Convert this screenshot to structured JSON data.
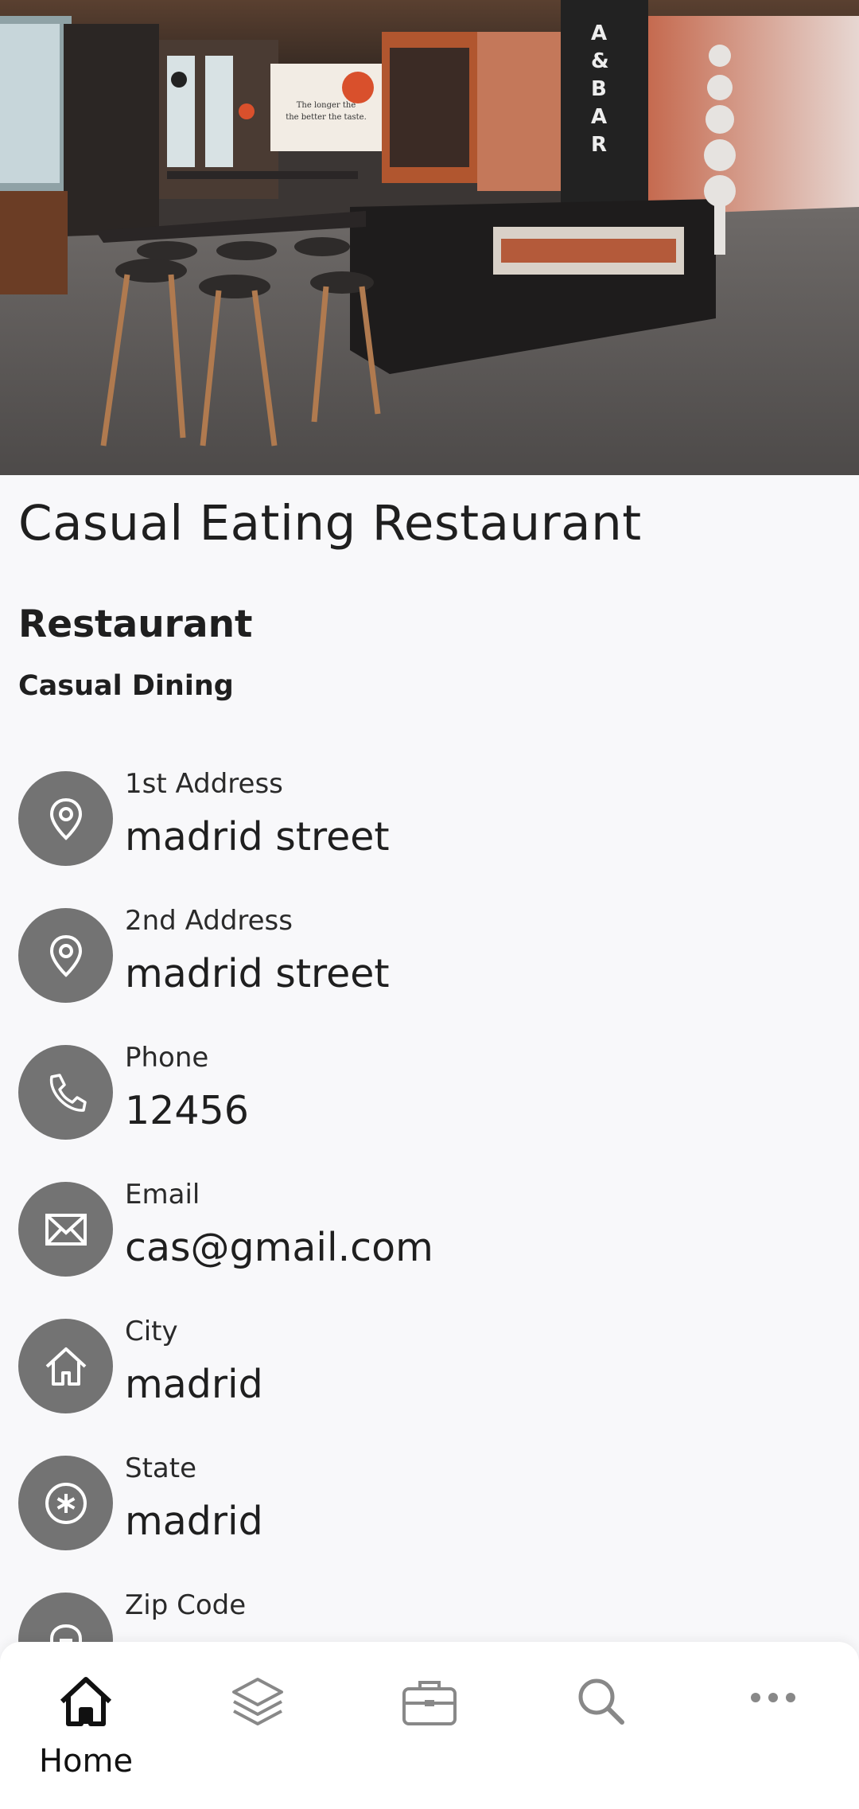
{
  "restaurant": {
    "name": "Casual Eating Restaurant",
    "category": "Restaurant",
    "subcategory": "Casual Dining"
  },
  "hero": {
    "signage": [
      "A",
      "&",
      "B",
      "A",
      "R"
    ],
    "board_lines": [
      "The longer the",
      "the better the taste."
    ]
  },
  "info": [
    {
      "label": "1st Address",
      "value": "madrid street",
      "icon": "location-pin-icon"
    },
    {
      "label": "2nd Address",
      "value": "madrid street",
      "icon": "location-pin-icon"
    },
    {
      "label": "Phone",
      "value": "12456",
      "icon": "phone-icon"
    },
    {
      "label": "Email",
      "value": "cas@gmail.com",
      "icon": "envelope-icon"
    },
    {
      "label": "City",
      "value": "madrid",
      "icon": "house-icon"
    },
    {
      "label": "State",
      "value": "madrid",
      "icon": "asterisk-circle-icon"
    },
    {
      "label": "Zip Code",
      "value": "",
      "icon": "mailbox-icon"
    }
  ],
  "nav": {
    "items": [
      {
        "label": "Home",
        "icon": "home-icon",
        "active": true
      },
      {
        "label": "",
        "icon": "layers-icon",
        "active": false
      },
      {
        "label": "",
        "icon": "briefcase-icon",
        "active": false
      },
      {
        "label": "",
        "icon": "search-icon",
        "active": false
      },
      {
        "label": "",
        "icon": "more-icon",
        "active": false
      }
    ]
  },
  "colors": {
    "icon_circle": "#737373",
    "background": "#f8f8fa",
    "nav_background": "#ffffff"
  }
}
